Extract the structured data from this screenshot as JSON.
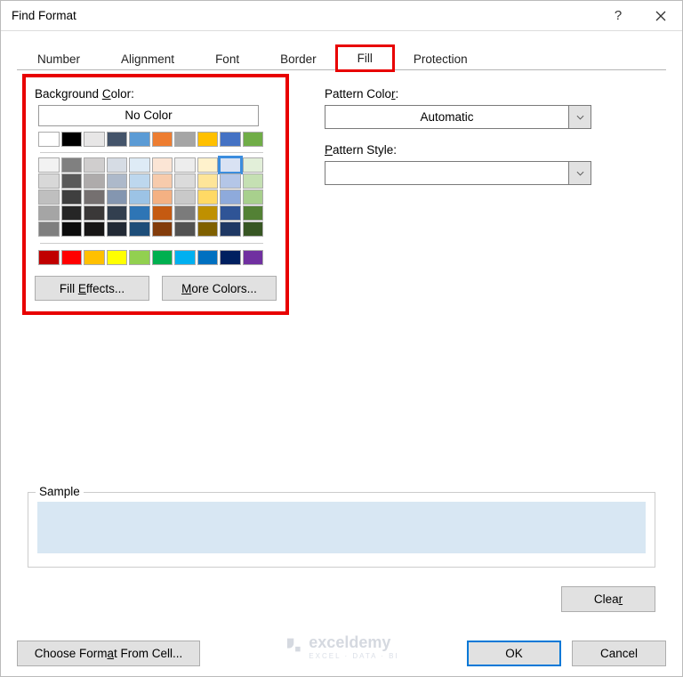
{
  "title": "Find Format",
  "tabs": [
    "Number",
    "Alignment",
    "Font",
    "Border",
    "Fill",
    "Protection"
  ],
  "activeTab": "Fill",
  "bg": {
    "label": "Background Color:",
    "underlineChar": "C",
    "noColor": "No Color",
    "row1": [
      "#FFFFFF",
      "#000000",
      "#E7E6E6",
      "#44546A",
      "#5B9BD5",
      "#ED7D31",
      "#A5A5A5",
      "#FFC000",
      "#4472C4",
      "#70AD47"
    ],
    "grid": [
      [
        "#F2F2F2",
        "#808080",
        "#D0CECE",
        "#D6DCE4",
        "#DEEBF6",
        "#FBE5D5",
        "#EDEDED",
        "#FFF2CC",
        "#D9E2F3",
        "#E2EFD9"
      ],
      [
        "#D8D8D8",
        "#595959",
        "#AEABAB",
        "#ADB9CA",
        "#BDD7EE",
        "#F7CBAC",
        "#DBDBDB",
        "#FEE599",
        "#B4C6E7",
        "#C5E0B3"
      ],
      [
        "#BFBFBF",
        "#3F3F3F",
        "#757070",
        "#8496B0",
        "#9CC3E5",
        "#F4B183",
        "#C9C9C9",
        "#FFD965",
        "#8EAADB",
        "#A8D08D"
      ],
      [
        "#A5A5A5",
        "#262626",
        "#3A3838",
        "#323F4F",
        "#2E75B5",
        "#C55A11",
        "#7B7B7B",
        "#BF9000",
        "#2F5496",
        "#538135"
      ],
      [
        "#7F7F7F",
        "#0C0C0C",
        "#171616",
        "#222A35",
        "#1E4E79",
        "#833C0B",
        "#525252",
        "#7F6000",
        "#1F3864",
        "#375623"
      ]
    ],
    "standard": [
      "#C00000",
      "#FF0000",
      "#FFC000",
      "#FFFF00",
      "#92D050",
      "#00B050",
      "#00B0F0",
      "#0070C0",
      "#002060",
      "#7030A0"
    ],
    "selected": {
      "row": 0,
      "col": 8
    },
    "fillEffects": "Fill Effects...",
    "moreColors": "More Colors..."
  },
  "pattern": {
    "colorLabel": "Pattern Color:",
    "colorValue": "Automatic",
    "styleLabel": "Pattern Style:",
    "styleValue": ""
  },
  "sample": {
    "label": "Sample",
    "color": "#D8E7F3"
  },
  "buttons": {
    "clear": "Clear",
    "chooseFormat": "Choose Format From Cell...",
    "ok": "OK",
    "cancel": "Cancel"
  },
  "watermark": {
    "name": "exceldemy",
    "tagline": "EXCEL · DATA · BI"
  }
}
